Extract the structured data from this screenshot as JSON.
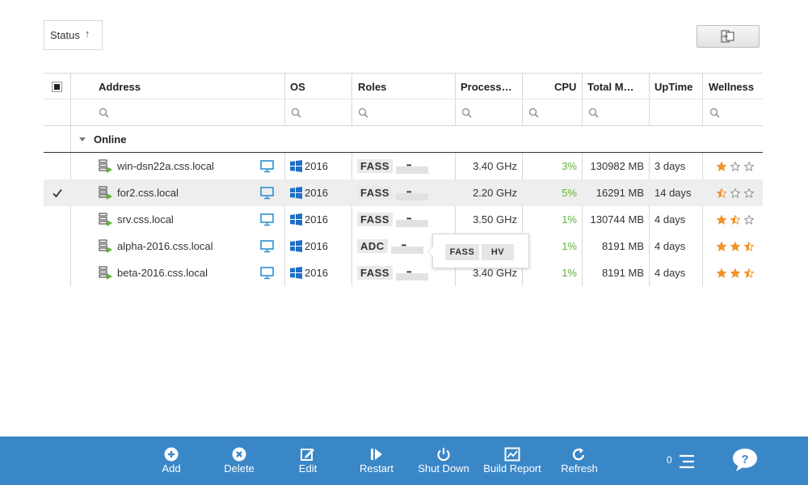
{
  "status_sort": {
    "label": "Status",
    "arrow": "↑"
  },
  "columns": {
    "address": "Address",
    "os": "OS",
    "roles": "Roles",
    "processor": "Process…",
    "cpu": "CPU",
    "memory": "Total M…",
    "uptime": "UpTime",
    "wellness": "Wellness"
  },
  "group": {
    "label": "Online"
  },
  "rows": [
    {
      "address": "win-dsn22a.css.local",
      "os": "2016",
      "role": "FASS",
      "processor": "3.40 GHz",
      "cpu": "3%",
      "memory": "130982 MB",
      "uptime": "3 days",
      "wellness": 1.0,
      "selected": false
    },
    {
      "address": "for2.css.local",
      "os": "2016",
      "role": "FASS",
      "processor": "2.20 GHz",
      "cpu": "5%",
      "memory": "16291 MB",
      "uptime": "14 days",
      "wellness": 0.5,
      "selected": true
    },
    {
      "address": "srv.css.local",
      "os": "2016",
      "role": "FASS",
      "processor": "3.50 GHz",
      "cpu": "1%",
      "memory": "130744 MB",
      "uptime": "4 days",
      "wellness": 1.5,
      "selected": false
    },
    {
      "address": "alpha-2016.css.local",
      "os": "2016",
      "role": "ADC",
      "processor": "",
      "cpu": "1%",
      "memory": "8191 MB",
      "uptime": "4 days",
      "wellness": 2.5,
      "selected": false
    },
    {
      "address": "beta-2016.css.local",
      "os": "2016",
      "role": "FASS",
      "processor": "3.40 GHz",
      "cpu": "1%",
      "memory": "8191 MB",
      "uptime": "4 days",
      "wellness": 2.5,
      "selected": false
    }
  ],
  "popover_roles": [
    "FASS",
    "HV"
  ],
  "toolbar": {
    "add": "Add",
    "delete": "Delete",
    "edit": "Edit",
    "restart": "Restart",
    "shutdown": "Shut Down",
    "build_report": "Build Report",
    "refresh": "Refresh",
    "queue_count": "0"
  },
  "colors": {
    "toolbar_bg": "#3a87c8",
    "star": "#f0922b",
    "cpu_text": "#5fb435",
    "monitor": "#2e8fd0",
    "windows": "#1f6fc5"
  }
}
